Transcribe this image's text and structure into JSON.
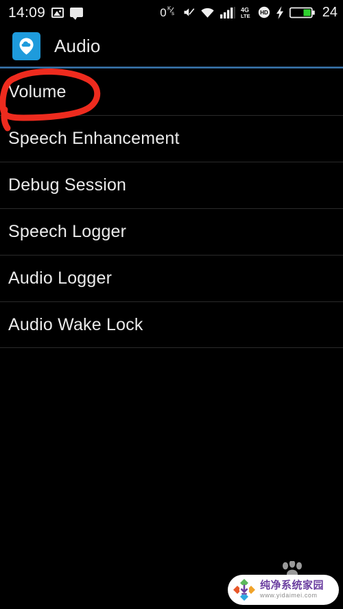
{
  "status_bar": {
    "clock": "14:09",
    "left_icons": [
      {
        "name": "photo-icon",
        "label": "photo"
      },
      {
        "name": "message-icon",
        "label": "message"
      }
    ],
    "data_rate": "0",
    "data_rate_unit_top": "K",
    "data_rate_unit_bottom": "s",
    "right_icons": [
      {
        "name": "mute-icon",
        "label": "silent"
      },
      {
        "name": "wifi-icon",
        "label": "wifi"
      },
      {
        "name": "signal-bars-icon",
        "label": "signal"
      },
      {
        "name": "network-4g-lte-icon",
        "label": "4G LTE"
      },
      {
        "name": "hd-voice-icon",
        "label": "HD"
      },
      {
        "name": "charging-bolt-icon",
        "label": "charging"
      },
      {
        "name": "battery-icon",
        "label": "battery"
      }
    ],
    "network_4g": "4G",
    "network_lte": "LTE",
    "hd_label": "HD",
    "battery_percent": "24"
  },
  "header": {
    "title": "Audio",
    "app_icon_name": "audio-app-icon",
    "accent_color": "#1e9bdc",
    "rule_color": "#3d7fb8"
  },
  "list": {
    "rows": [
      {
        "label": "Volume",
        "highlighted": true
      },
      {
        "label": "Speech Enhancement",
        "highlighted": false
      },
      {
        "label": "Debug Session",
        "highlighted": false
      },
      {
        "label": "Speech Logger",
        "highlighted": false
      },
      {
        "label": "Audio Logger",
        "highlighted": false
      },
      {
        "label": "Audio Wake Lock",
        "highlighted": false
      }
    ]
  },
  "annotation": {
    "name": "red-circle-annotation",
    "target": "Volume",
    "color": "#ee2b1e"
  },
  "watermark": {
    "paw_icon_name": "paw-print-icon",
    "logo_icon_name": "download-diamond-logo",
    "site_name_cn": "纯净系统家园",
    "site_url": "www.yidaimei.com",
    "text_color": "#6b3fa0",
    "url_color": "#8a8a8a"
  }
}
